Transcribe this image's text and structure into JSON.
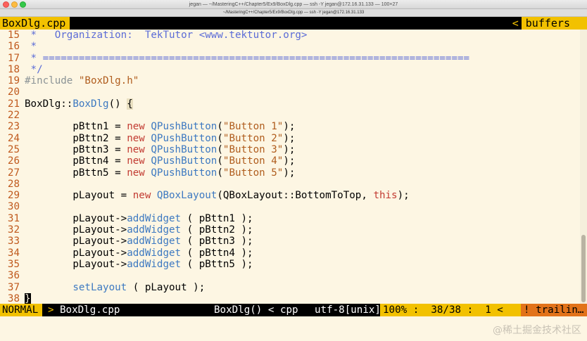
{
  "window": {
    "title": "jegan — ~/MasteringC++/Chapter5/Ex9/BoxDlg.cpp — ssh -Y jegan@172.16.31.133 — 100×27",
    "tab_label": "~/MasteringC++/Chapter5/Ex9/BoxDlg.cpp — ssh -Y jegan@172.16.31.133"
  },
  "vim": {
    "tab_file": "BoxDlg.cpp",
    "tab_right_sep": "<",
    "tab_right_label": "buffers",
    "lines": [
      {
        "n": "15",
        "code": [
          {
            "c": "cmt",
            "t": " *   Organization:  TekTutor <www.tektutor.org>"
          }
        ]
      },
      {
        "n": "16",
        "code": [
          {
            "c": "cmt",
            "t": " *"
          }
        ]
      },
      {
        "n": "17",
        "code": [
          {
            "c": "cmt",
            "t": " * ======================================================================="
          }
        ]
      },
      {
        "n": "18",
        "code": [
          {
            "c": "cmt",
            "t": " */"
          }
        ]
      },
      {
        "n": "19",
        "code": [
          {
            "c": "pre",
            "t": "#include "
          },
          {
            "c": "str",
            "t": "\"BoxDlg.h\""
          }
        ]
      },
      {
        "n": "20",
        "code": []
      },
      {
        "n": "21",
        "code": [
          {
            "c": "",
            "t": "BoxDlg::"
          },
          {
            "c": "fn",
            "t": "BoxDlg"
          },
          {
            "c": "",
            "t": "() "
          },
          {
            "c": "hl-brace",
            "t": "{"
          }
        ]
      },
      {
        "n": "22",
        "code": []
      },
      {
        "n": "23",
        "code": [
          {
            "c": "",
            "t": "        pBttn1 = "
          },
          {
            "c": "kw",
            "t": "new"
          },
          {
            "c": "",
            "t": " "
          },
          {
            "c": "cls",
            "t": "QPushButton"
          },
          {
            "c": "",
            "t": "("
          },
          {
            "c": "str",
            "t": "\"Button 1\""
          },
          {
            "c": "",
            "t": ");"
          }
        ]
      },
      {
        "n": "24",
        "code": [
          {
            "c": "",
            "t": "        pBttn2 = "
          },
          {
            "c": "kw",
            "t": "new"
          },
          {
            "c": "",
            "t": " "
          },
          {
            "c": "cls",
            "t": "QPushButton"
          },
          {
            "c": "",
            "t": "("
          },
          {
            "c": "str",
            "t": "\"Button 2\""
          },
          {
            "c": "",
            "t": ");"
          }
        ]
      },
      {
        "n": "25",
        "code": [
          {
            "c": "",
            "t": "        pBttn3 = "
          },
          {
            "c": "kw",
            "t": "new"
          },
          {
            "c": "",
            "t": " "
          },
          {
            "c": "cls",
            "t": "QPushButton"
          },
          {
            "c": "",
            "t": "("
          },
          {
            "c": "str",
            "t": "\"Button 3\""
          },
          {
            "c": "",
            "t": ");"
          }
        ]
      },
      {
        "n": "26",
        "code": [
          {
            "c": "",
            "t": "        pBttn4 = "
          },
          {
            "c": "kw",
            "t": "new"
          },
          {
            "c": "",
            "t": " "
          },
          {
            "c": "cls",
            "t": "QPushButton"
          },
          {
            "c": "",
            "t": "("
          },
          {
            "c": "str",
            "t": "\"Button 4\""
          },
          {
            "c": "",
            "t": ");"
          }
        ]
      },
      {
        "n": "27",
        "code": [
          {
            "c": "",
            "t": "        pBttn5 = "
          },
          {
            "c": "kw",
            "t": "new"
          },
          {
            "c": "",
            "t": " "
          },
          {
            "c": "cls",
            "t": "QPushButton"
          },
          {
            "c": "",
            "t": "("
          },
          {
            "c": "str",
            "t": "\"Button 5\""
          },
          {
            "c": "",
            "t": ");"
          }
        ]
      },
      {
        "n": "28",
        "code": []
      },
      {
        "n": "29",
        "code": [
          {
            "c": "",
            "t": "        pLayout = "
          },
          {
            "c": "kw",
            "t": "new"
          },
          {
            "c": "",
            "t": " "
          },
          {
            "c": "cls",
            "t": "QBoxLayout"
          },
          {
            "c": "",
            "t": "(QBoxLayout::BottomToTop, "
          },
          {
            "c": "kw",
            "t": "this"
          },
          {
            "c": "",
            "t": ");"
          }
        ]
      },
      {
        "n": "30",
        "code": []
      },
      {
        "n": "31",
        "code": [
          {
            "c": "",
            "t": "        pLayout->"
          },
          {
            "c": "fn",
            "t": "addWidget"
          },
          {
            "c": "",
            "t": " ( pBttn1 );"
          }
        ]
      },
      {
        "n": "32",
        "code": [
          {
            "c": "",
            "t": "        pLayout->"
          },
          {
            "c": "fn",
            "t": "addWidget"
          },
          {
            "c": "",
            "t": " ( pBttn2 );"
          }
        ]
      },
      {
        "n": "33",
        "code": [
          {
            "c": "",
            "t": "        pLayout->"
          },
          {
            "c": "fn",
            "t": "addWidget"
          },
          {
            "c": "",
            "t": " ( pBttn3 );"
          }
        ]
      },
      {
        "n": "34",
        "code": [
          {
            "c": "",
            "t": "        pLayout->"
          },
          {
            "c": "fn",
            "t": "addWidget"
          },
          {
            "c": "",
            "t": " ( pBttn4 );"
          }
        ]
      },
      {
        "n": "35",
        "code": [
          {
            "c": "",
            "t": "        pLayout->"
          },
          {
            "c": "fn",
            "t": "addWidget"
          },
          {
            "c": "",
            "t": " ( pBttn5 );"
          }
        ]
      },
      {
        "n": "36",
        "code": []
      },
      {
        "n": "37",
        "code": [
          {
            "c": "",
            "t": "        "
          },
          {
            "c": "fn",
            "t": "setLayout"
          },
          {
            "c": "",
            "t": " ( pLayout );"
          }
        ]
      },
      {
        "n": "38",
        "code": [
          {
            "c": "cursor",
            "t": "}"
          }
        ]
      }
    ],
    "status": {
      "mode": "NORMAL",
      "arrow": ">",
      "file": "BoxDlg.cpp",
      "function": "BoxDlg() < cpp",
      "encoding": "utf-8[unix] <",
      "position": "100% :  38/38 :  1 <",
      "warning": "! trailin…"
    }
  },
  "watermark": "@稀土掘金技术社区",
  "colors": {
    "background": "#fdf6e3",
    "accent_yellow": "#f2c100",
    "warning_orange": "#e2731a",
    "line_number": "#c05a1e",
    "comment": "#5b6cd7",
    "keyword": "#c23b32",
    "type": "#3d79c1",
    "string": "#b05d1e"
  }
}
